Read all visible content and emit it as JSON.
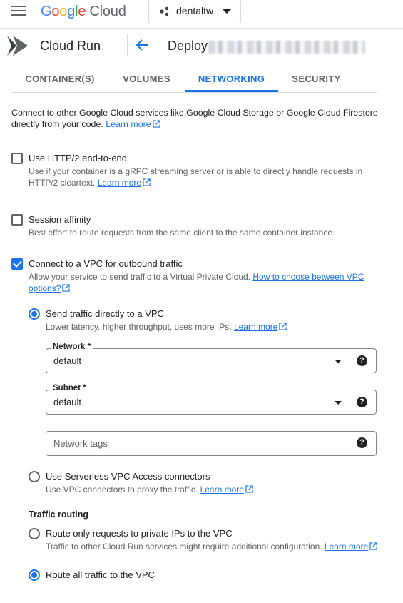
{
  "header": {
    "logo_google": "Google",
    "logo_cloud": "Cloud",
    "project_name": "dentaltw"
  },
  "service": {
    "name": "Cloud Run",
    "page_title": "Deploy"
  },
  "tabs": [
    {
      "label": "CONTAINER(S)",
      "active": false
    },
    {
      "label": "VOLUMES",
      "active": false
    },
    {
      "label": "NETWORKING",
      "active": true
    },
    {
      "label": "SECURITY",
      "active": false
    }
  ],
  "intro": {
    "text": "Connect to other Google Cloud services like Google Cloud Storage or Google Cloud Firestore directly from your code.",
    "link": "Learn more"
  },
  "options": {
    "http2": {
      "label": "Use HTTP/2 end-to-end",
      "checked": false,
      "desc": "Use if your container is a gRPC streaming server or is able to directly handle requests in HTTP/2 cleartext.",
      "link": "Learn more"
    },
    "session": {
      "label": "Session affinity",
      "checked": false,
      "desc": "Best effort to route requests from the same client to the same container instance."
    },
    "vpc": {
      "label": "Connect to a VPC for outbound traffic",
      "checked": true,
      "desc": "Allow your service to send traffic to a Virtual Private Cloud.",
      "link": "How to choose between VPC options?"
    }
  },
  "vpc_mode": {
    "direct": {
      "label": "Send traffic directly to a VPC",
      "checked": true,
      "desc": "Lower latency, higher throughput, uses more IPs.",
      "link": "Learn more"
    },
    "connectors": {
      "label": "Use Serverless VPC Access connectors",
      "checked": false,
      "desc": "Use VPC connectors to proxy the traffic.",
      "link": "Learn more"
    }
  },
  "fields": {
    "network": {
      "label": "Network *",
      "value": "default"
    },
    "subnet": {
      "label": "Subnet *",
      "value": "default"
    },
    "tags": {
      "placeholder": "Network tags"
    }
  },
  "traffic_routing": {
    "heading": "Traffic routing",
    "private": {
      "label": "Route only requests to private IPs to the VPC",
      "checked": false,
      "desc": "Traffic to other Cloud Run services might require additional configuration.",
      "link": "Learn more"
    },
    "all": {
      "label": "Route all traffic to the VPC",
      "checked": true
    }
  },
  "colors": {
    "accent": "#1a73e8",
    "text": "#202124",
    "muted": "#5f6368"
  },
  "icons": [
    "menu-icon",
    "cloud-run-logo",
    "project-icon",
    "back-arrow-icon",
    "external-link-icon",
    "help-icon",
    "dropdown-caret-icon"
  ]
}
